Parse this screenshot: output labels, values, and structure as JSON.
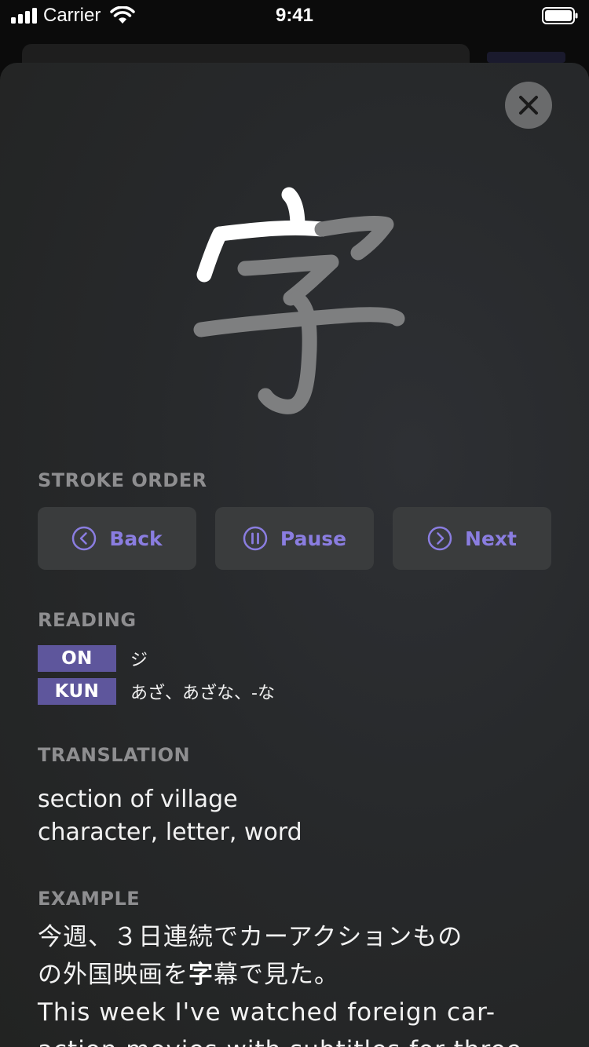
{
  "status_bar": {
    "carrier": "Carrier",
    "time": "9:41"
  },
  "kanji": {
    "character": "字"
  },
  "stroke_order": {
    "label": "STROKE ORDER",
    "back": "Back",
    "pause": "Pause",
    "next": "Next"
  },
  "reading": {
    "label": "READING",
    "on_tag": "ON",
    "on_value": "ジ",
    "kun_tag": "KUN",
    "kun_value": "あざ、あざな、-な"
  },
  "translation": {
    "label": "TRANSLATION",
    "line1": "section of village",
    "line2": "character, letter, word"
  },
  "example": {
    "label": "EXAMPLE",
    "jp_line1": "今週、３日連続でカーアクションもの",
    "jp_line2_pre": "の外国映画を",
    "jp_line2_highlight": "字",
    "jp_line2_post": "幕で見た。",
    "en_line1": "This week I've watched foreign car-",
    "en_line2": "action movies with subtitles for three"
  },
  "colors": {
    "accent": "#8a7de0",
    "tag_bg": "#5e569c",
    "label_gray": "#8e8e90",
    "button_bg": "#3a3c3d"
  }
}
